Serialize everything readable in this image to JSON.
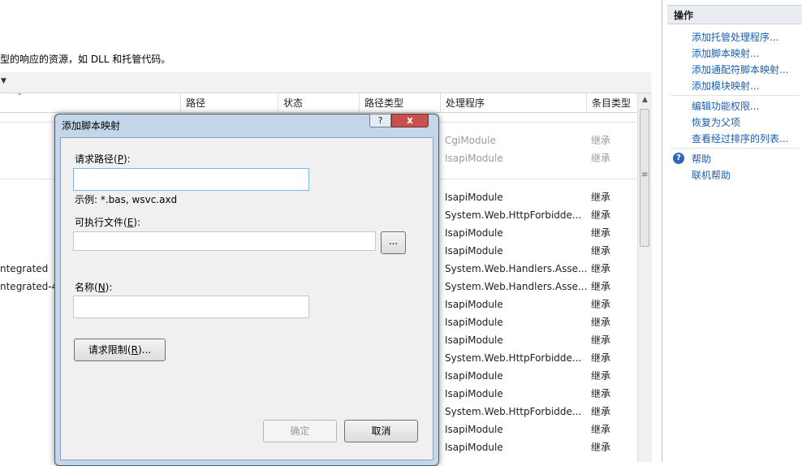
{
  "main": {
    "description": "型的响应的资源，如 DLL 和托管代码。",
    "columns": [
      "路径",
      "状态",
      "路径类型",
      "处理程序",
      "条目类型"
    ],
    "left_fragments": [
      "ntegrated",
      "ntegrated-4."
    ],
    "rows_top": [
      {
        "handler": "CgiModule",
        "entry": "继承"
      },
      {
        "handler": "IsapiModule",
        "entry": "继承"
      }
    ],
    "rows": [
      {
        "handler": "IsapiModule",
        "entry": "继承"
      },
      {
        "handler": "System.Web.HttpForbidde...",
        "entry": "继承"
      },
      {
        "handler": "IsapiModule",
        "entry": "继承"
      },
      {
        "handler": "IsapiModule",
        "entry": "继承"
      },
      {
        "handler": "System.Web.Handlers.Asse...",
        "entry": "继承"
      },
      {
        "handler": "System.Web.Handlers.Asse...",
        "entry": "继承"
      },
      {
        "handler": "IsapiModule",
        "entry": "继承"
      },
      {
        "handler": "IsapiModule",
        "entry": "继承"
      },
      {
        "handler": "IsapiModule",
        "entry": "继承"
      },
      {
        "handler": "System.Web.HttpForbidde...",
        "entry": "继承"
      },
      {
        "handler": "IsapiModule",
        "entry": "继承"
      },
      {
        "handler": "IsapiModule",
        "entry": "继承"
      },
      {
        "handler": "System.Web.HttpForbidde...",
        "entry": "继承"
      },
      {
        "handler": "IsapiModule",
        "entry": "继承"
      },
      {
        "handler": "IsapiModule",
        "entry": "继承"
      }
    ]
  },
  "actions": {
    "title": "操作",
    "group1": [
      "添加托管处理程序...",
      "添加脚本映射...",
      "添加通配符脚本映射...",
      "添加模块映射..."
    ],
    "group2": [
      "编辑功能权限...",
      "恢复为父项",
      "查看经过排序的列表..."
    ],
    "help": "帮助",
    "online_help": "联机帮助"
  },
  "dialog": {
    "title": "添加脚本映射",
    "help_btn": "?",
    "close_btn": "x",
    "request_path_label_pre": "请求路径(",
    "request_path_key": "P",
    "request_path_label_post": "):",
    "request_path_value": "",
    "example": "示例: *.bas, wsvc.axd",
    "executable_label_pre": "可执行文件(",
    "executable_key": "E",
    "executable_label_post": "):",
    "executable_value": "",
    "browse_btn": "...",
    "name_label_pre": "名称(",
    "name_key": "N",
    "name_label_post": "):",
    "name_value": "",
    "restrictions_pre": "请求限制(",
    "restrictions_key": "R",
    "restrictions_post": ")...",
    "ok": "确定",
    "cancel": "取消"
  }
}
